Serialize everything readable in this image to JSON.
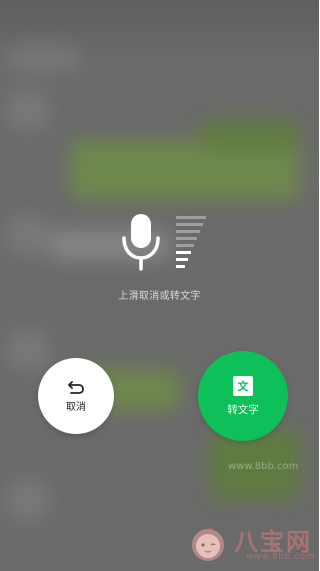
{
  "overlay": {
    "hint_text": "上滑取消或转文字",
    "mic_icon": "microphone-icon",
    "level_icon": "volume-level-icon"
  },
  "actions": {
    "cancel": {
      "label": "取消",
      "icon": "undo-arrow-icon"
    },
    "convert": {
      "label": "转文字",
      "icon_text": "文"
    }
  },
  "watermark": {
    "title": "八宝网",
    "url": "www.8bb.com",
    "faint_url": "www.8bb.com"
  },
  "colors": {
    "accent_green": "#0ec05a",
    "overlay_gray": "#6a6a6a",
    "text_light": "#d9d9d9",
    "button_white": "#ffffff"
  }
}
